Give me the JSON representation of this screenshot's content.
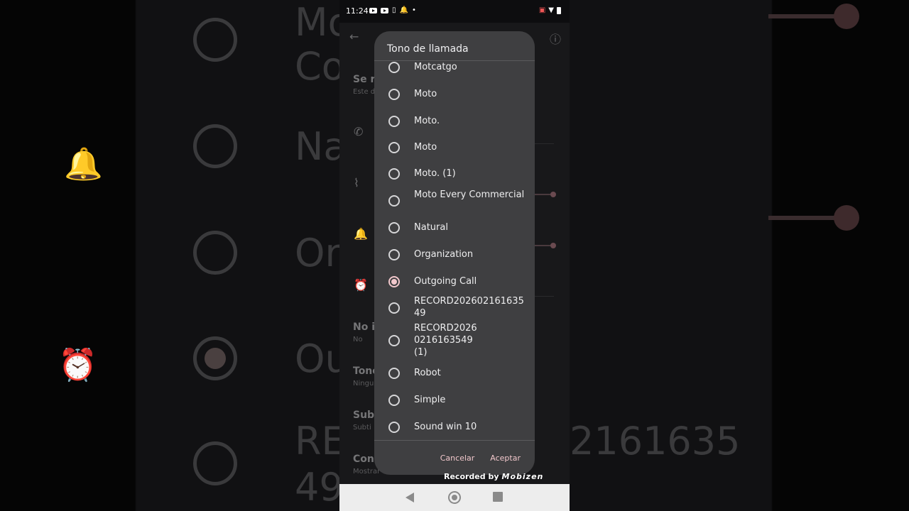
{
  "status_bar": {
    "time": "11:24",
    "icons": [
      "youtube-icon",
      "youtube-icon",
      "phone-icon",
      "bell-icon",
      "dot-icon",
      "cast-icon",
      "wifi-icon",
      "battery-icon"
    ]
  },
  "background_settings": {
    "partial_labels": [
      {
        "title": "Se r",
        "subtitle": "Este d"
      },
      {
        "title": "No i",
        "subtitle": "No"
      },
      {
        "title": "Tono",
        "subtitle": "Ningu"
      },
      {
        "title": "Sub",
        "subtitle": "Subti"
      },
      {
        "title": "Con",
        "subtitle": "Mostrar"
      }
    ]
  },
  "dialog": {
    "title": "Tono de llamada",
    "options": [
      {
        "label": "Motcatgo",
        "checked": false
      },
      {
        "label": "Moto",
        "checked": false
      },
      {
        "label": "Moto.",
        "checked": false
      },
      {
        "label": "Moto",
        "checked": false
      },
      {
        "label": "Moto. (1)",
        "checked": false
      },
      {
        "label": "Moto Every Commercial",
        "checked": false
      },
      {
        "label": "Natural",
        "checked": false
      },
      {
        "label": "Organization",
        "checked": false
      },
      {
        "label": "Outgoing Call",
        "checked": true
      },
      {
        "label": "RECORD20260216163549",
        "checked": false
      },
      {
        "label": "RECORD20260216163549 (1)",
        "checked": false
      },
      {
        "label": "Robot",
        "checked": false
      },
      {
        "label": "Simple",
        "checked": false
      },
      {
        "label": "Sound win 10",
        "checked": false
      }
    ],
    "cancel_label": "Cancelar",
    "accept_label": "Aceptar"
  },
  "watermark": {
    "prefix": "Recorded by",
    "brand": "Mobizen"
  },
  "blurred_background": {
    "left_texts": [
      "Mo",
      "Co",
      "Na",
      "Or",
      "Ou",
      "RE",
      "49"
    ],
    "right_texts": [
      "2161635"
    ]
  },
  "colors": {
    "dialog_bg": "#3f3f41",
    "accent": "#f1c7cb",
    "text": "#eeeeef"
  }
}
